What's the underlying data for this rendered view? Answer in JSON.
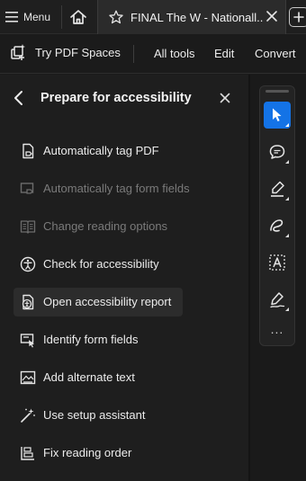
{
  "tabbar": {
    "menu_label": "Menu",
    "tab_title": "FINAL The W - Nationall...",
    "icons": [
      "hamburger-icon",
      "home-icon",
      "star-icon",
      "close-icon",
      "plus-icon"
    ]
  },
  "toolbar": {
    "spaces_label": "Try PDF Spaces",
    "all_tools": "All tools",
    "edit": "Edit",
    "convert": "Convert"
  },
  "panel": {
    "title": "Prepare for accessibility",
    "items": [
      {
        "label": "Automatically tag PDF",
        "enabled": true,
        "icon": "document-tag-icon"
      },
      {
        "label": "Automatically tag form fields",
        "enabled": false,
        "icon": "form-tag-icon"
      },
      {
        "label": "Change reading options",
        "enabled": false,
        "icon": "book-icon"
      },
      {
        "label": "Check for accessibility",
        "enabled": true,
        "icon": "accessibility-check-icon"
      },
      {
        "label": "Open accessibility report",
        "enabled": true,
        "active": true,
        "icon": "accessibility-report-icon"
      },
      {
        "label": "Identify form fields",
        "enabled": true,
        "icon": "form-identify-icon"
      },
      {
        "label": "Add alternate text",
        "enabled": true,
        "icon": "alt-text-icon"
      },
      {
        "label": "Use setup assistant",
        "enabled": true,
        "icon": "wand-icon"
      },
      {
        "label": "Fix reading order",
        "enabled": true,
        "icon": "reading-order-icon"
      }
    ]
  },
  "rail": {
    "tools": [
      "select-cursor-icon",
      "comment-icon",
      "highlight-pen-icon",
      "draw-freehand-icon",
      "text-box-icon",
      "sign-icon"
    ],
    "more_label": "..."
  },
  "colors": {
    "background": "#1b1b1b",
    "panel": "#1e1e1e",
    "accent": "#1473e6",
    "text": "#ececec",
    "disabled_text": "#7a7a7a"
  }
}
